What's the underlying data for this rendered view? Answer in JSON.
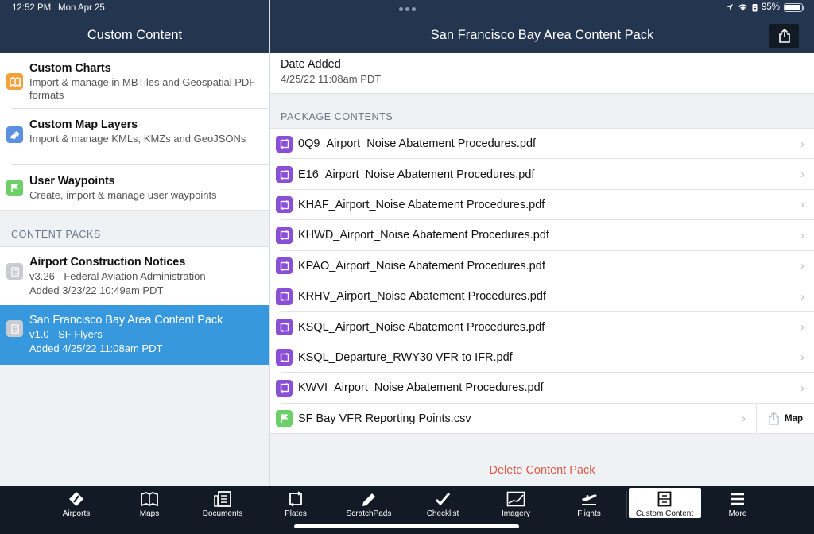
{
  "status_bar": {
    "time": "12:52 PM",
    "date": "Mon Apr 25",
    "battery": "95%",
    "battery_level": 0.95
  },
  "left": {
    "title": "Custom Content",
    "items": [
      {
        "title": "Custom Charts",
        "subtitle": "Import & manage in MBTiles and Geospatial PDF formats",
        "icon": "map-book-icon",
        "color": "#f0a23b"
      },
      {
        "title": "Custom Map Layers",
        "subtitle": "Import & manage KMLs, KMZs and GeoJSONs",
        "icon": "map-layers-icon",
        "color": "#5b8fe0"
      },
      {
        "title": "User Waypoints",
        "subtitle": "Create, import & manage user waypoints",
        "icon": "flag-icon",
        "color": "#6ccf6a"
      }
    ],
    "section_label": "CONTENT PACKS",
    "packs": [
      {
        "title": "Airport Construction Notices",
        "line1": "v3.26 - Federal Aviation Administration",
        "line2": "Added 3/23/22 10:49am PDT",
        "selected": false
      },
      {
        "title": "San Francisco Bay Area Content Pack",
        "line1": "v1.0 - SF Flyers",
        "line2": "Added 4/25/22 11:08am PDT",
        "selected": true
      }
    ]
  },
  "right": {
    "title": "San Francisco Bay Area Content Pack",
    "date_label": "Date Added",
    "date_value": "4/25/22 11:08am PDT",
    "section_label": "PACKAGE CONTENTS",
    "files": [
      {
        "name": "0Q9_Airport_Noise Abatement Procedures.pdf",
        "type": "plate"
      },
      {
        "name": "E16_Airport_Noise Abatement Procedures.pdf",
        "type": "plate"
      },
      {
        "name": "KHAF_Airport_Noise Abatement Procedures.pdf",
        "type": "plate"
      },
      {
        "name": "KHWD_Airport_Noise Abatement Procedures.pdf",
        "type": "plate"
      },
      {
        "name": "KPAO_Airport_Noise Abatement Procedures.pdf",
        "type": "plate"
      },
      {
        "name": "KRHV_Airport_Noise Abatement Procedures.pdf",
        "type": "plate"
      },
      {
        "name": "KSQL_Airport_Noise Abatement Procedures.pdf",
        "type": "plate"
      },
      {
        "name": "KSQL_Departure_RWY30 VFR to IFR.pdf",
        "type": "plate"
      },
      {
        "name": "KWVI_Airport_Noise Abatement Procedures.pdf",
        "type": "plate"
      },
      {
        "name": "SF Bay VFR Reporting Points.csv",
        "type": "waypoints"
      }
    ],
    "map_button": "Map",
    "delete_label": "Delete Content Pack",
    "colors": {
      "plate": "#8a4fd6",
      "waypoints": "#6ccf6a",
      "delete": "#dc5a4a",
      "selected": "#3798dd"
    }
  },
  "tabs": [
    {
      "label": "Airports",
      "icon": "airport-icon"
    },
    {
      "label": "Maps",
      "icon": "maps-icon"
    },
    {
      "label": "Documents",
      "icon": "documents-icon"
    },
    {
      "label": "Plates",
      "icon": "plates-icon"
    },
    {
      "label": "ScratchPads",
      "icon": "pencil-icon"
    },
    {
      "label": "Checklist",
      "icon": "checkmark-icon"
    },
    {
      "label": "Imagery",
      "icon": "imagery-icon"
    },
    {
      "label": "Flights",
      "icon": "plane-departure-icon"
    },
    {
      "label": "Custom Content",
      "icon": "cabinet-icon",
      "active": true
    },
    {
      "label": "More",
      "icon": "menu-icon"
    }
  ]
}
